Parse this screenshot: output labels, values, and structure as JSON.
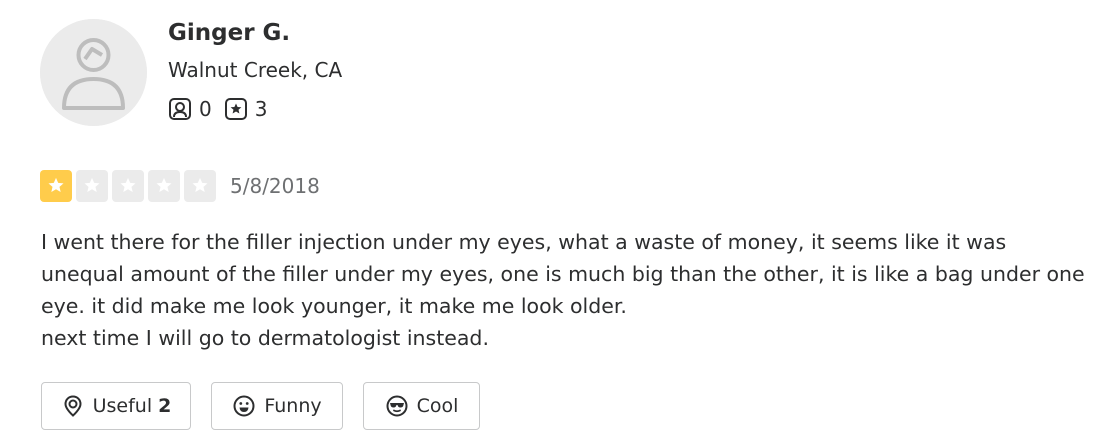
{
  "user": {
    "name": "Ginger G.",
    "location": "Walnut Creek, CA",
    "friends_count": "0",
    "reviews_count": "3"
  },
  "review": {
    "rating": 1,
    "max_rating": 5,
    "date": "5/8/2018",
    "paragraphs": [
      "I went there for the filler injection under my eyes, what a waste of money, it seems like it was unequal amount of the filler under my eyes, one is much big than the other, it is like a bag under one eye. it did make me look younger, it make me look older.",
      "next time I will go to dermatologist instead."
    ]
  },
  "actions": {
    "useful_label": "Useful",
    "useful_count": "2",
    "funny_label": "Funny",
    "cool_label": "Cool"
  },
  "colors": {
    "star_filled": "#ffcc4b",
    "star_empty": "#ebebeb",
    "text": "#2d2e2f",
    "muted": "#6e7072",
    "border": "#c8c9ca"
  },
  "icons": {
    "avatar": "default-user-icon",
    "friends": "friends-icon",
    "reviews": "review-star-icon",
    "useful": "lightbulb-icon",
    "funny": "smiley-icon",
    "cool": "sunglasses-icon"
  }
}
